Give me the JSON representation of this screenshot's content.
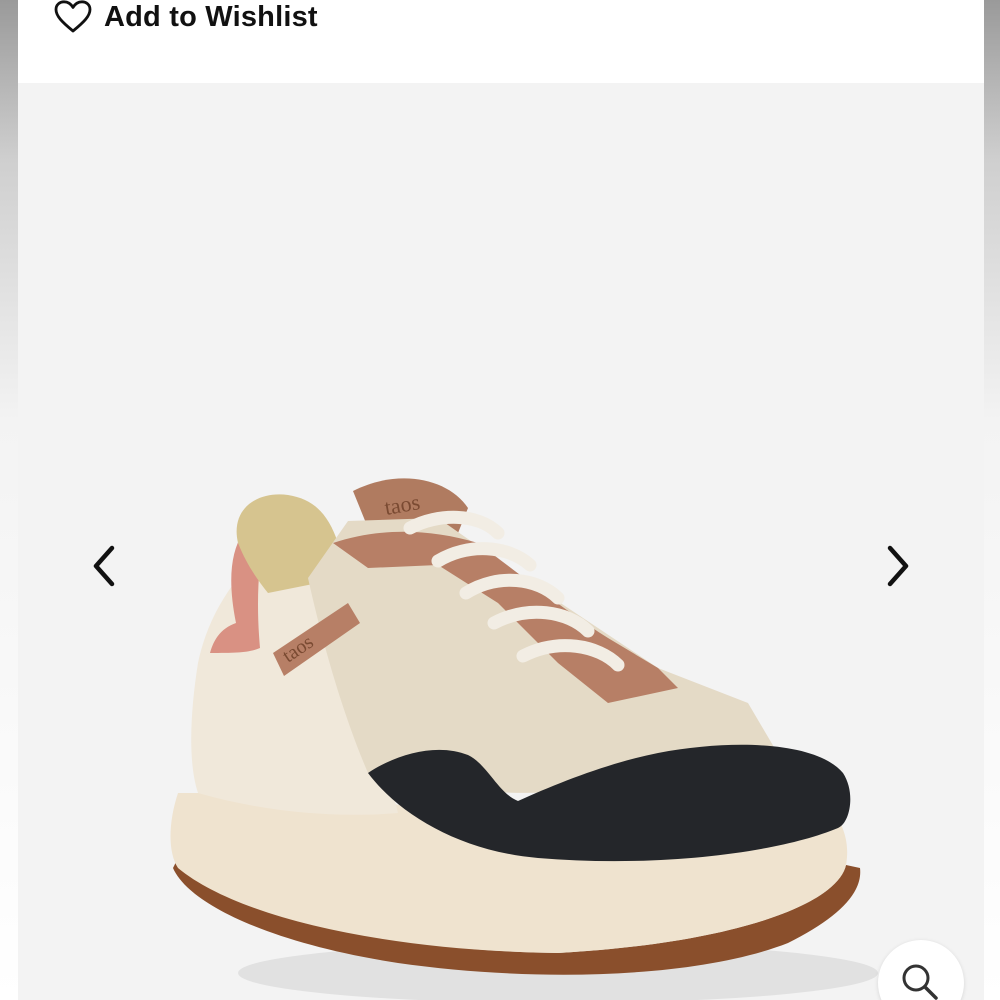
{
  "wishlist": {
    "label": "Add to Wishlist",
    "icon": "heart-outline-icon"
  },
  "gallery": {
    "product_image_alt": "taos sneaker",
    "prev_icon": "chevron-left-icon",
    "next_icon": "chevron-right-icon",
    "zoom_icon": "magnifier-icon",
    "logo_text": "taos"
  },
  "colors": {
    "background": "#f3f3f3",
    "card": "#ffffff",
    "text": "#111111",
    "accent_leather": "#b77f66",
    "accent_pink": "#d99183",
    "toe_black": "#24262a",
    "sole_cream": "#efe3cf"
  }
}
